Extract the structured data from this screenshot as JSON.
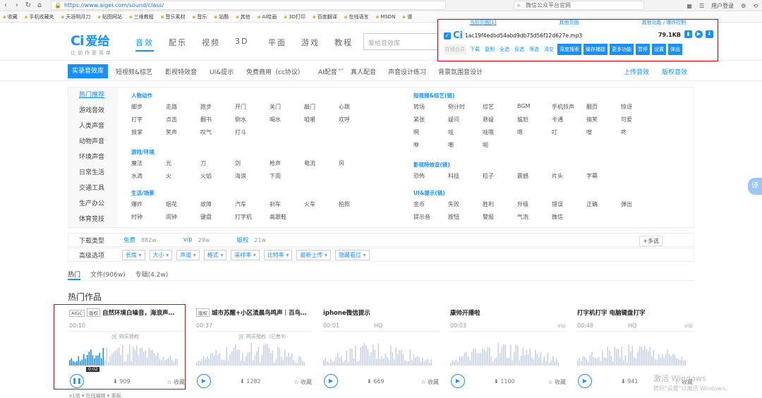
{
  "browser": {
    "url": "https://www.aigei.com/sound/class/",
    "search": "微信公众平台官网",
    "right_label": "用户登录"
  },
  "bookmarks": [
    "收藏",
    "手机收藏夹",
    "天涯明月刀",
    "贴图网站",
    "三维教程",
    "音乐素材",
    "音乐",
    "站酷",
    "其他",
    "AI绘画",
    "3D打印",
    "百度翻译",
    "在线语言",
    "MSDN",
    "谱"
  ],
  "site": {
    "logo_mark": "Ci",
    "logo_name": "爱给",
    "logo_tag": "让创作更简单",
    "nav": [
      "音效",
      "配乐",
      "视频",
      "3D",
      "平面",
      "游戏",
      "教程"
    ],
    "search_placeholder": "爱给音效库"
  },
  "subnav": {
    "items": [
      "实录音效库",
      "短视频&综艺",
      "影视特效音",
      "UI&提示",
      "免费商用（cc协议）",
      "AI配音",
      "真人配音",
      "声音设计练习",
      "背景氛围音设计"
    ],
    "ai_sup": "+*",
    "right": [
      "上传音效",
      "版权音效"
    ]
  },
  "catpanel": {
    "left": [
      "热门推荐",
      "游戏音效",
      "人类声音",
      "动物声音",
      "环境声音",
      "日常生活",
      "交通工具",
      "生产办公",
      "体育竞技"
    ],
    "groups": [
      {
        "title": "人物动作",
        "rows": [
          [
            "脚步",
            "走路",
            "跑步",
            "开门",
            "关门",
            "敲门",
            "心跳"
          ],
          [
            "打字",
            "点击",
            "翻书",
            "倒水",
            "喝水",
            "咀嚼",
            "欢呼"
          ],
          [
            "鼓掌",
            "笑声",
            "叹气",
            "打斗"
          ]
        ]
      },
      {
        "title": "游戏/环境",
        "rows": [
          [
            "魔法",
            "光",
            "刀",
            "剑",
            "枪声",
            "电流",
            "风"
          ],
          [
            "水滴",
            "火",
            "火焰",
            "海浪",
            "下雨"
          ]
        ]
      },
      {
        "title": "生活/场景",
        "rows": [
          [
            "爆炸",
            "烟花",
            "故障",
            "汽车",
            "刹车",
            "火车",
            "拍照"
          ],
          [
            "时钟",
            "闹钟",
            "键盘",
            "打字机",
            "高跟鞋"
          ]
        ]
      },
      {
        "title": "短视频&综艺(链)",
        "rows": [
          [
            "转场",
            "倒计时",
            "综艺",
            "BGM",
            "手机铃声",
            "翻页",
            "惊讶"
          ],
          [
            "紧张",
            "疑问",
            "悬疑",
            "尴尬",
            "卡通",
            "搞笑",
            "可爱"
          ],
          [
            "啊",
            "哇",
            "哇哦",
            "嗯",
            "叮",
            "嗖",
            "咚"
          ],
          [
            "咻",
            "嘲",
            "啪"
          ]
        ]
      },
      {
        "title": "影视特效音(链)",
        "rows": [
          [
            "恐怖",
            "科技",
            "粒子",
            "震撼",
            "片头",
            "字幕"
          ]
        ]
      },
      {
        "title": "UI&提示(链)",
        "rows": [
          [
            "金币",
            "失败",
            "胜利",
            "升级",
            "错误",
            "正确",
            "弹出"
          ],
          [
            "提示音",
            "按钮",
            "警报",
            "气泡",
            "微信"
          ]
        ]
      }
    ]
  },
  "filters": {
    "download_label": "下载类型",
    "download_opts": [
      {
        "name": "免费",
        "count": "882w"
      },
      {
        "name": "vip",
        "count": "29w"
      },
      {
        "name": "版权",
        "count": "21w"
      }
    ],
    "multi": "+多选",
    "advanced_label": "高级选项",
    "advanced_opts": [
      "长度",
      "大小",
      "声道",
      "格式",
      "采样率",
      "比特率",
      "最新上传",
      "隐藏看过"
    ]
  },
  "tabs": [
    "热门",
    "文件(906w)",
    "专辑(4.2w)"
  ],
  "section_title": "热门作品",
  "cards": [
    {
      "badges": [
        "AIGC",
        "版权"
      ],
      "title": "自然环境白噪音，海浪声…",
      "duration": "00:10",
      "quality": "",
      "tag": "",
      "buy": "购买授权",
      "downloads": "909",
      "fav": "收藏",
      "playing": true,
      "tip": "0:02",
      "below": "x1倍 ▾      在线编辑 ▾      事报"
    },
    {
      "badges": [
        "版权"
      ],
      "title": "城市苏醒+小区清晨鸟鸣声｜百鸟…",
      "duration": "00:37",
      "quality": "",
      "tag": "",
      "buy": "购买授权（已售3）",
      "downloads": "1282",
      "fav": "收藏",
      "playing": false,
      "tip": "",
      "below": ""
    },
    {
      "badges": [],
      "title": "iphone微信提示",
      "duration": "00:01",
      "quality": "HQ",
      "tag": "",
      "buy": "",
      "downloads": "669",
      "fav": "收藏",
      "playing": false,
      "tip": "",
      "below": ""
    },
    {
      "badges": [],
      "title": "康帅开播啦",
      "duration": "00:03",
      "quality": "",
      "tag": "vip",
      "buy": "",
      "downloads": "1100",
      "fav": "收藏",
      "playing": false,
      "tip": "",
      "below": ""
    },
    {
      "badges": [],
      "title": "打字机打字 电脑键盘打字",
      "duration": "00:48",
      "quality": "HQ",
      "tag": "vip",
      "buy": "",
      "downloads": "941",
      "fav": "收藏",
      "playing": false,
      "tip": "",
      "below": ""
    }
  ],
  "download_panel": {
    "tabs": [
      "当前页面[1]",
      "其他页面",
      "其他功能 / 爆炸控制"
    ],
    "filename": "1ac19f4edbd54abd9db75d56f12d627e.mp3",
    "size": "79.1KB",
    "buttons": [
      "在线合并",
      "下载",
      "复制",
      "全选",
      "反选",
      "筛选",
      "清空"
    ],
    "solid_buttons": [
      "深度搜索",
      "缓存捕捉",
      "更多功能",
      "暂停",
      "设置",
      "弹出"
    ]
  },
  "side_tab": "译",
  "watermark": {
    "line1": "激活 Windows",
    "line2": "转到\"设置\"以激活 Windows。"
  },
  "colors": {
    "accent": "#1890ff",
    "highlight": "#e60012"
  }
}
